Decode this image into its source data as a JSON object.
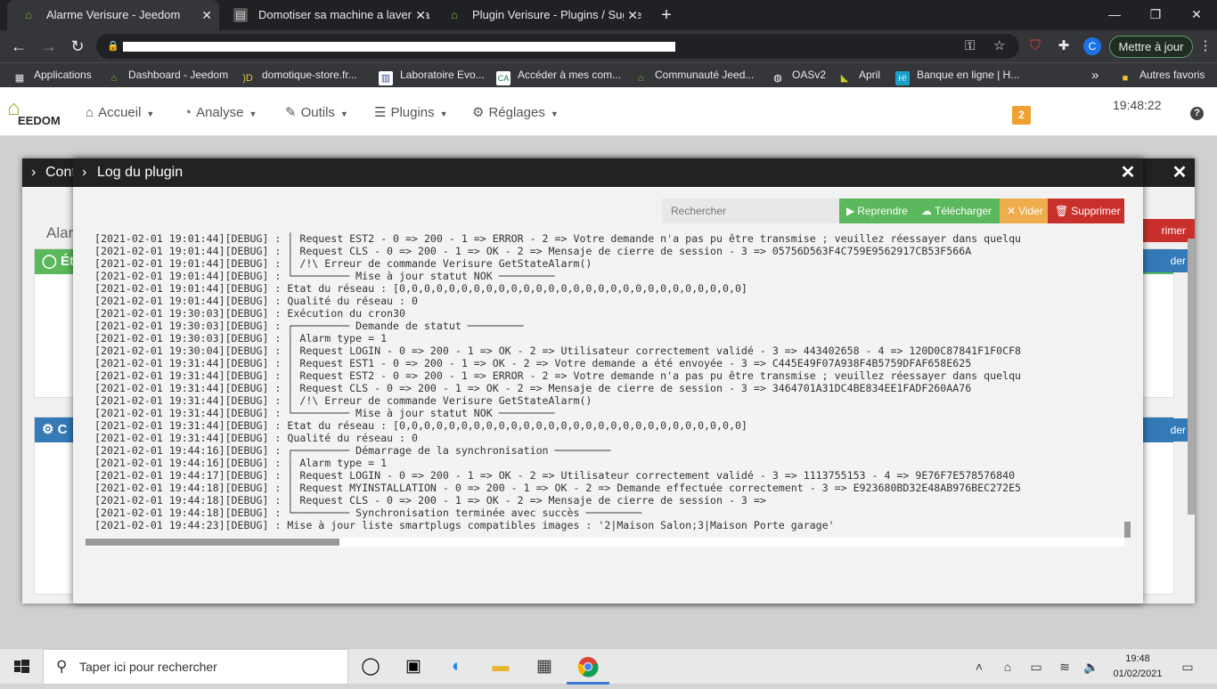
{
  "browser": {
    "tabs": [
      {
        "title": "Alarme Verisure - Jeedom",
        "icon": "jeedom-icon"
      },
      {
        "title": "Domotiser sa machine a laver via",
        "icon": "page-icon"
      },
      {
        "title": "Plugin Verisure - Plugins / Sugge",
        "icon": "jeedom-icon"
      }
    ],
    "new_tab_label": "+",
    "update_button": "Mettre à jour",
    "profile_initial": "C",
    "bookmarks": [
      {
        "label": "Applications",
        "icon": "apps-grid-icon"
      },
      {
        "label": "Dashboard - Jeedom",
        "icon": "jeedom-icon"
      },
      {
        "label": "domotique-store.fr...",
        "icon": "store-icon"
      },
      {
        "label": "Laboratoire Evo...",
        "icon": "lab-icon"
      },
      {
        "label": "Accéder à mes com...",
        "icon": "bank-icon"
      },
      {
        "label": "Communauté Jeed...",
        "icon": "jeedom-icon"
      },
      {
        "label": "OASv2",
        "icon": "globe-icon"
      },
      {
        "label": "April",
        "icon": "april-icon"
      },
      {
        "label": "Banque en ligne | H...",
        "icon": "hello-bank-icon"
      }
    ],
    "bookmarks_overflow": "»",
    "other_bookmarks": "Autres favoris"
  },
  "jeedom": {
    "logo_text": "EEDOM",
    "menu": [
      {
        "label": "Accueil",
        "icon": "home-icon"
      },
      {
        "label": "Analyse",
        "icon": "gauge-icon"
      },
      {
        "label": "Outils",
        "icon": "wrench-icon"
      },
      {
        "label": "Plugins",
        "icon": "list-icon"
      },
      {
        "label": "Réglages",
        "icon": "gear-icon"
      }
    ],
    "notification_count": "2",
    "time": "19:48:22",
    "help_label": "?"
  },
  "background_modal": {
    "breadcrumb": "Conf",
    "heading_partial": "Alar",
    "panel1_title": "Ét",
    "panel2_title": "C",
    "btn_delete": "rimer",
    "btn_save": "der",
    "btn_save2": "der"
  },
  "log_modal": {
    "title": "Log du plugin",
    "search_placeholder": "Rechercher",
    "buttons": {
      "resume": "Reprendre",
      "download": "Télécharger",
      "clear": "Vider",
      "delete": "Supprimer"
    },
    "lines": [
      "[2021-02-01 19:01:44][DEBUG] : │ Request EST2 - 0 => 200 - 1 => ERROR - 2 => Votre demande n'a pas pu être transmise ; veuillez réessayer dans quelqu",
      "[2021-02-01 19:01:44][DEBUG] : │ Request CLS - 0 => 200 - 1 => OK - 2 => Mensaje de cierre de session - 3 => 05756D563F4C759E9562917CB53F566A",
      "[2021-02-01 19:01:44][DEBUG] : │ /!\\ Erreur de commande Verisure GetStateAlarm()",
      "[2021-02-01 19:01:44][DEBUG] : └───────── Mise à jour statut NOK ─────────",
      "[2021-02-01 19:01:44][DEBUG] : Etat du réseau : [0,0,0,0,0,0,0,0,0,0,0,0,0,0,0,0,0,0,0,0,0,0,0,0,0,0,0,0]",
      "[2021-02-01 19:01:44][DEBUG] : Qualité du réseau : 0",
      "[2021-02-01 19:30:03][DEBUG] : Exécution du cron30",
      "[2021-02-01 19:30:03][DEBUG] : ┌───────── Demande de statut ─────────",
      "[2021-02-01 19:30:03][DEBUG] : │ Alarm type = 1",
      "[2021-02-01 19:30:04][DEBUG] : │ Request LOGIN - 0 => 200 - 1 => OK - 2 => Utilisateur correctement validé - 3 => 443402658 - 4 => 120D0C87841F1F0CF8",
      "[2021-02-01 19:31:44][DEBUG] : │ Request EST1 - 0 => 200 - 1 => OK - 2 => Votre demande a été envoyée - 3 => C445E49F07A938F4B5759DFAF658E625",
      "[2021-02-01 19:31:44][DEBUG] : │ Request EST2 - 0 => 200 - 1 => ERROR - 2 => Votre demande n'a pas pu être transmise ; veuillez réessayer dans quelqu",
      "[2021-02-01 19:31:44][DEBUG] : │ Request CLS - 0 => 200 - 1 => OK - 2 => Mensaje de cierre de session - 3 => 3464701A31DC4BE834EE1FADF260AA76",
      "[2021-02-01 19:31:44][DEBUG] : │ /!\\ Erreur de commande Verisure GetStateAlarm()",
      "[2021-02-01 19:31:44][DEBUG] : └───────── Mise à jour statut NOK ─────────",
      "[2021-02-01 19:31:44][DEBUG] : Etat du réseau : [0,0,0,0,0,0,0,0,0,0,0,0,0,0,0,0,0,0,0,0,0,0,0,0,0,0,0,0]",
      "[2021-02-01 19:31:44][DEBUG] : Qualité du réseau : 0",
      "[2021-02-01 19:44:16][DEBUG] : ┌───────── Démarrage de la synchronisation ─────────",
      "[2021-02-01 19:44:16][DEBUG] : │ Alarm type = 1",
      "[2021-02-01 19:44:17][DEBUG] : │ Request LOGIN - 0 => 200 - 1 => OK - 2 => Utilisateur correctement validé - 3 => 1113755153 - 4 => 9E76F7E578576840",
      "[2021-02-01 19:44:18][DEBUG] : │ Request MYINSTALLATION - 0 => 200 - 1 => OK - 2 => Demande effectuée correctement - 3 => E923680BD32E48AB976BEC272E5",
      "[2021-02-01 19:44:18][DEBUG] : │ Request CLS - 0 => 200 - 1 => OK - 2 => Mensaje de cierre de session - 3 =>",
      "[2021-02-01 19:44:18][DEBUG] : └───────── Synchronisation terminée avec succès ─────────",
      "[2021-02-01 19:44:23][DEBUG] : Mise à jour liste smartplugs compatibles images : '2|Maison Salon;3|Maison Porte garage'"
    ]
  },
  "taskbar": {
    "search_placeholder": "Taper ici pour rechercher",
    "time": "19:48",
    "date": "01/02/2021"
  },
  "colors": {
    "green": "#5cb85c",
    "orange": "#f0ad4e",
    "red": "#d9534f",
    "blue": "#337ab7",
    "dark_header": "#222222"
  }
}
